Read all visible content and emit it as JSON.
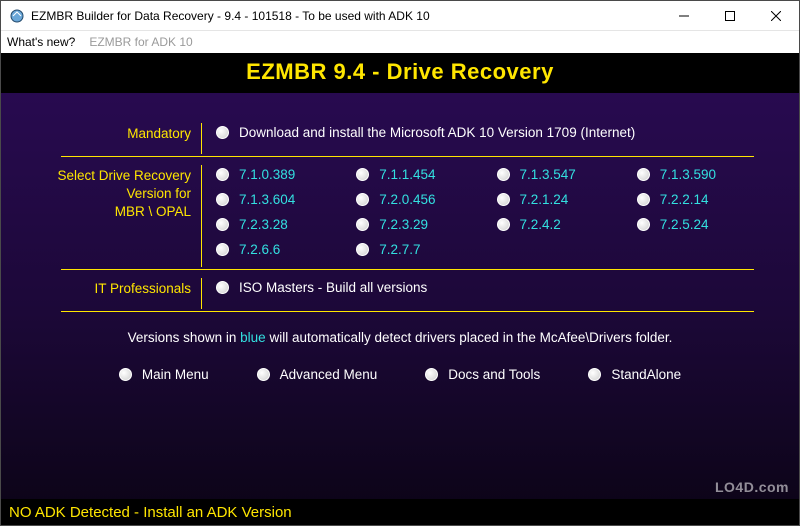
{
  "window": {
    "title": "EZMBR Builder for Data Recovery - 9.4 - 101518 - To be used with ADK 10"
  },
  "menu": {
    "whats_new": "What's new?",
    "ezmbr_adk": "EZMBR for ADK 10"
  },
  "banner": "EZMBR 9.4 - Drive Recovery",
  "mandatory": {
    "label": "Mandatory",
    "option": "Download and install the Microsoft ADK 10 Version 1709 (Internet)"
  },
  "versions": {
    "label_line1": "Select Drive Recovery",
    "label_line2": "Version for",
    "label_line3": "MBR \\ OPAL",
    "items": [
      "7.1.0.389",
      "7.1.1.454",
      "7.1.3.547",
      "7.1.3.590",
      "7.1.3.604",
      "7.2.0.456",
      "7.2.1.24",
      "7.2.2.14",
      "7.2.3.28",
      "7.2.3.29",
      "7.2.4.2",
      "7.2.5.24",
      "7.2.6.6",
      "7.2.7.7"
    ]
  },
  "it_pro": {
    "label": "IT Professionals",
    "option": "ISO Masters - Build all versions"
  },
  "note": {
    "prefix": "Versions shown in ",
    "blue_word": "blue",
    "suffix": " will automatically detect drivers placed in the McAfee\\Drivers folder."
  },
  "bottom_options": {
    "main_menu": "Main Menu",
    "advanced_menu": "Advanced Menu",
    "docs_tools": "Docs and Tools",
    "standalone": "StandAlone"
  },
  "status": "NO ADK Detected - Install an ADK Version",
  "watermark": "LO4D.com"
}
